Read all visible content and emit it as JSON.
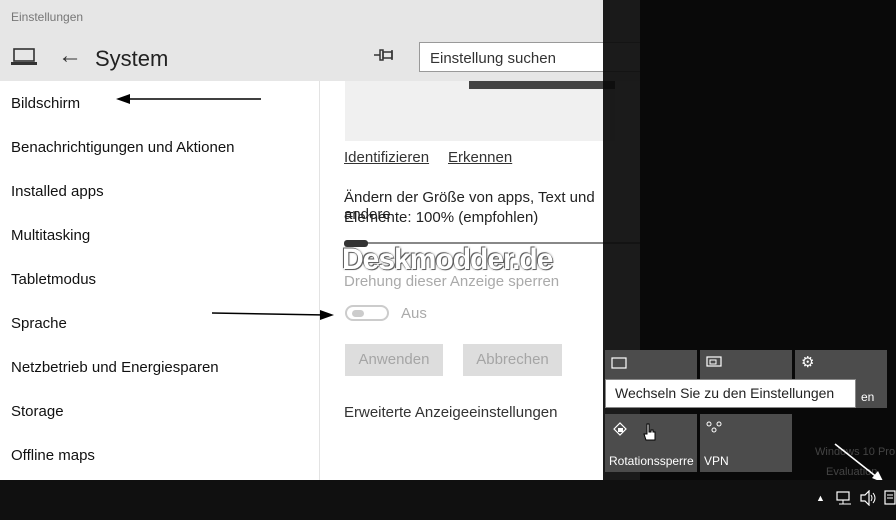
{
  "window": {
    "title": "Einstellungen",
    "page_title": "System",
    "back_icon": "←",
    "search_placeholder": "Einstellung suchen"
  },
  "nav": {
    "items": [
      {
        "label": "Bildschirm"
      },
      {
        "label": "Benachrichtigungen und Aktionen"
      },
      {
        "label": "Installed apps"
      },
      {
        "label": "Multitasking"
      },
      {
        "label": "Tabletmodus"
      },
      {
        "label": "Sprache"
      },
      {
        "label": "Netzbetrieb und Energiesparen"
      },
      {
        "label": "Storage"
      },
      {
        "label": "Offline maps"
      }
    ]
  },
  "display": {
    "identify_link": "Identifizieren",
    "detect_link": "Erkennen",
    "scale_line1": "Ändern der Größe von apps, Text und andere",
    "scale_line2": "Elemente: 100% (empfohlen)",
    "scale_value_percent": 100,
    "rotation_lock_label": "Drehung dieser Anzeige sperren",
    "rotation_toggle_state": "Aus",
    "apply_button": "Anwenden",
    "cancel_button": "Abbrechen",
    "advanced_link": "Erweiterte Anzeigeeinstellungen"
  },
  "watermark": "Deskmodder.de",
  "action_center": {
    "tiles_row1": [
      {
        "label": "",
        "icon": "tablet-icon"
      },
      {
        "label": "",
        "icon": "project-icon"
      },
      {
        "label": "en",
        "icon": "gear-icon"
      }
    ],
    "tiles_row2": [
      {
        "label": "Rotationssperre",
        "icon": "rotation-lock-icon"
      },
      {
        "label": "VPN",
        "icon": "vpn-icon"
      }
    ],
    "tooltip": "Wechseln Sie zu den Einstellungen",
    "faint_text_1": "Windows 10 Pro",
    "faint_text_2": "Evaluation"
  },
  "taskbar": {
    "tray_up_icon": "▲",
    "icons": [
      "network-icon",
      "volume-icon",
      "action-center-icon"
    ]
  },
  "colors": {
    "titlebar_bg": "#e6e6e6",
    "tile_bg": "#4c4c4c",
    "action_center_bg": "#0a0a0a",
    "taskbar_bg": "#101010"
  }
}
